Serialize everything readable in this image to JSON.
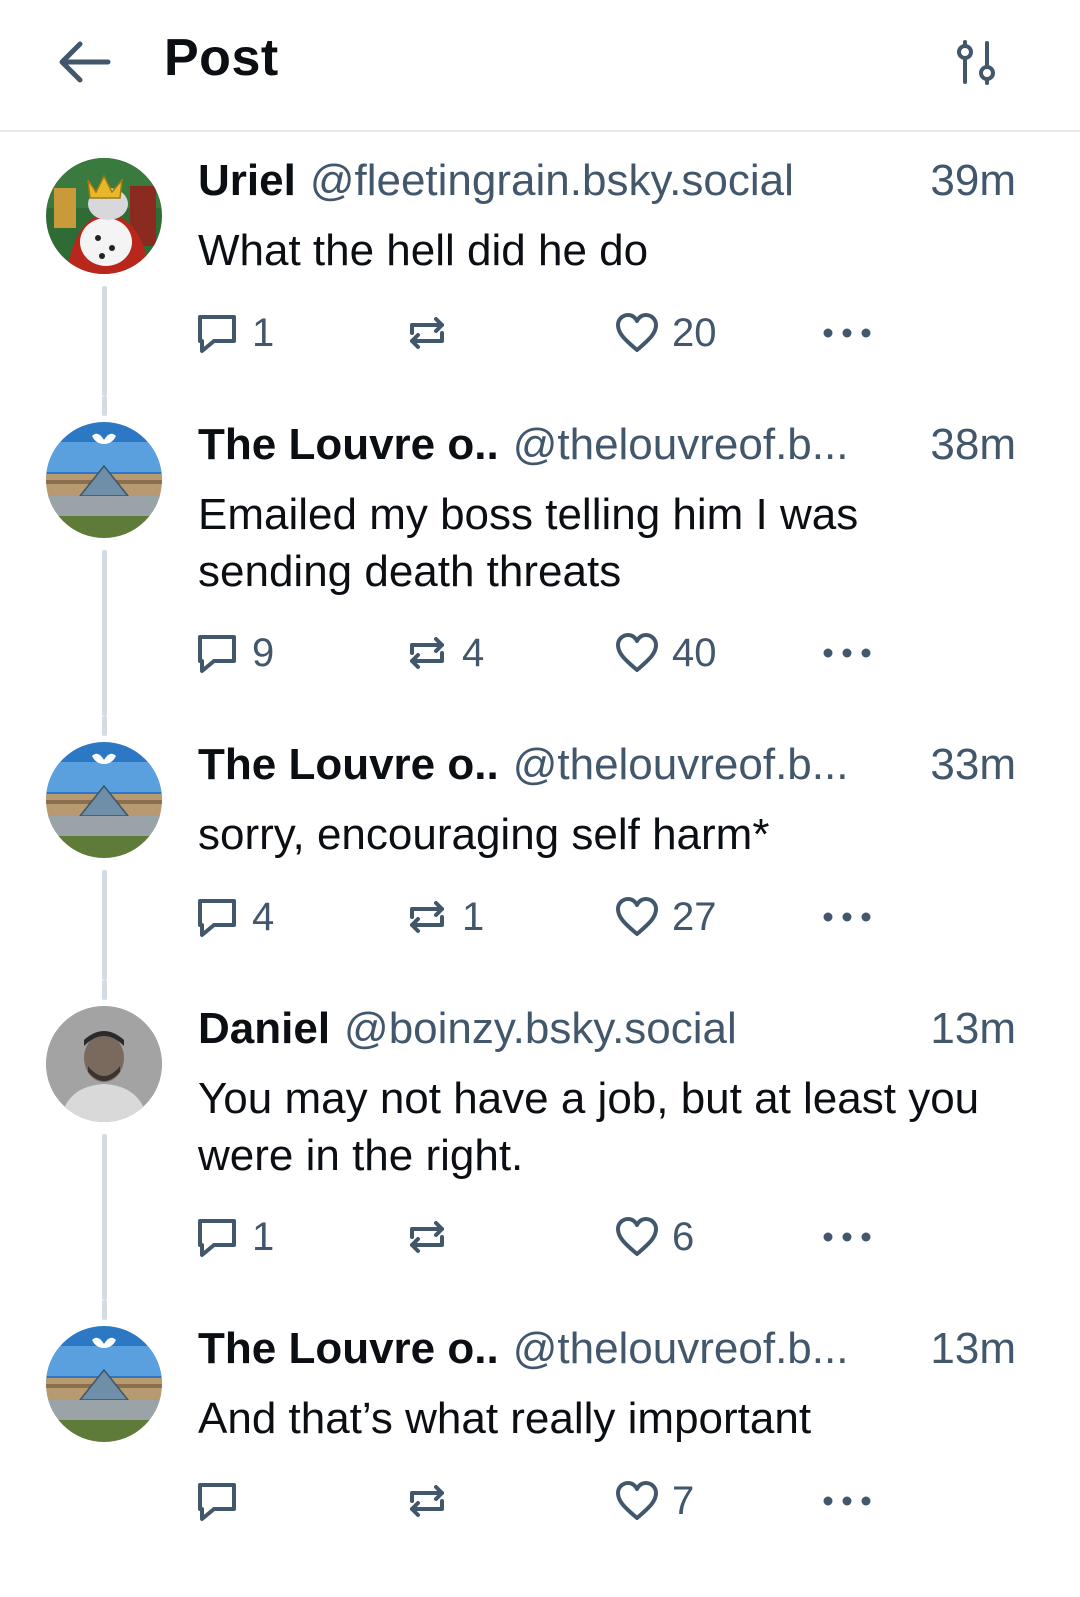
{
  "header": {
    "title": "Post",
    "back_icon": "arrow-left-icon",
    "settings_icon": "sliders-icon"
  },
  "colors": {
    "text": "#0b0f14",
    "muted": "#42576c",
    "thread_line": "#d4dbe3",
    "divider": "#e6ebf0"
  },
  "posts": [
    {
      "author": "Uriel",
      "handle": "@fleetingrain.bsky.social",
      "time": "39m",
      "text": "What the hell did he do",
      "avatar": "cartoon-king-avatar",
      "replies": "1",
      "reposts": "",
      "likes": "20"
    },
    {
      "author": "The Louvre o..",
      "handle": "@thelouvreof.b...",
      "time": "38m",
      "text": "Emailed my boss telling him I was sending death threats",
      "avatar": "louvre-avatar",
      "replies": "9",
      "reposts": "4",
      "likes": "40"
    },
    {
      "author": "The Louvre o..",
      "handle": "@thelouvreof.b...",
      "time": "33m",
      "text": "sorry, encouraging self harm*",
      "avatar": "louvre-avatar",
      "replies": "4",
      "reposts": "1",
      "likes": "27"
    },
    {
      "author": "Daniel",
      "handle": "@boinzy.bsky.social",
      "time": "13m",
      "text": "You may not have a job, but at least you were in the right.",
      "avatar": "person-photo-avatar",
      "replies": "1",
      "reposts": "",
      "likes": "6"
    },
    {
      "author": "The Louvre o..",
      "handle": "@thelouvreof.b...",
      "time": "13m",
      "text": "And that’s what really important",
      "avatar": "louvre-avatar",
      "replies": "",
      "reposts": "",
      "likes": "7"
    }
  ]
}
